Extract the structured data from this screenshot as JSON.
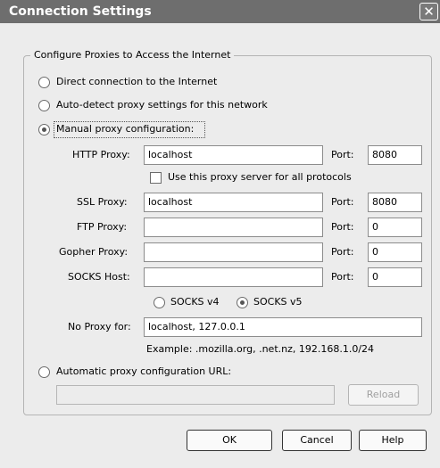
{
  "window": {
    "title": "Connection Settings",
    "close_glyph": "✕"
  },
  "group": {
    "legend": "Configure Proxies to Access the Internet"
  },
  "options": {
    "direct": "Direct connection to the Internet",
    "autodetect": "Auto-detect proxy settings for this network",
    "manual": "Manual proxy configuration:",
    "auto_url": "Automatic proxy configuration URL:"
  },
  "manual": {
    "http_label": "HTTP Proxy:",
    "http_value": "localhost",
    "http_port_label": "Port:",
    "http_port": "8080",
    "use_same_label": "Use this proxy server for all protocols",
    "ssl_label": "SSL Proxy:",
    "ssl_value": "localhost",
    "ssl_port_label": "Port:",
    "ssl_port": "8080",
    "ftp_label": "FTP Proxy:",
    "ftp_value": "",
    "ftp_port_label": "Port:",
    "ftp_port": "0",
    "gopher_label": "Gopher Proxy:",
    "gopher_value": "",
    "gopher_port_label": "Port:",
    "gopher_port": "0",
    "socks_label": "SOCKS Host:",
    "socks_value": "",
    "socks_port_label": "Port:",
    "socks_port": "0",
    "socks_v4": "SOCKS v4",
    "socks_v5": "SOCKS v5",
    "socks_selected": "SOCKS v5",
    "noproxy_label": "No Proxy for:",
    "noproxy_value": "localhost, 127.0.0.1",
    "example": "Example: .mozilla.org, .net.nz, 192.168.1.0/24"
  },
  "auto": {
    "url_value": "",
    "reload_label": "Reload"
  },
  "buttons": {
    "ok": "OK",
    "cancel": "Cancel",
    "help": "Help"
  },
  "selected_option": "manual",
  "use_same_checked": false,
  "icons": {
    "close": "close-icon",
    "radio": "radio-button",
    "checkbox": "checkbox"
  },
  "colors": {
    "titlebar": "#6e6e6e",
    "dialog_bg": "#ececec",
    "field_bg": "#ffffff"
  }
}
